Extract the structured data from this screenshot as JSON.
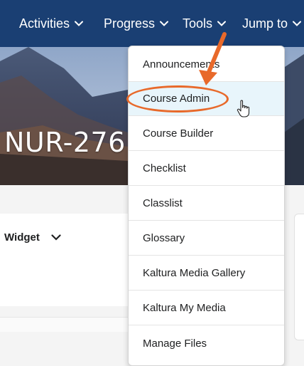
{
  "nav": {
    "items": [
      {
        "label": "Activities"
      },
      {
        "label": "Progress"
      },
      {
        "label": "Tools"
      },
      {
        "label": "Jump to"
      }
    ]
  },
  "banner": {
    "course_title": "NUR-276"
  },
  "widget": {
    "title": "Widget"
  },
  "tools_menu": {
    "items": [
      {
        "label": "Announcements"
      },
      {
        "label": "Course Admin",
        "highlighted": true
      },
      {
        "label": "Course Builder"
      },
      {
        "label": "Checklist"
      },
      {
        "label": "Classlist"
      },
      {
        "label": "Glossary"
      },
      {
        "label": "Kaltura Media Gallery"
      },
      {
        "label": "Kaltura My Media"
      },
      {
        "label": "Manage Files"
      }
    ]
  },
  "colors": {
    "navbar": "#1a3f73",
    "highlight_row": "#e8f5fb",
    "annotation": "#e8692a"
  },
  "icons": [
    "chevron-down-icon",
    "pointer-hand-cursor-icon",
    "annotation-arrow-icon"
  ]
}
